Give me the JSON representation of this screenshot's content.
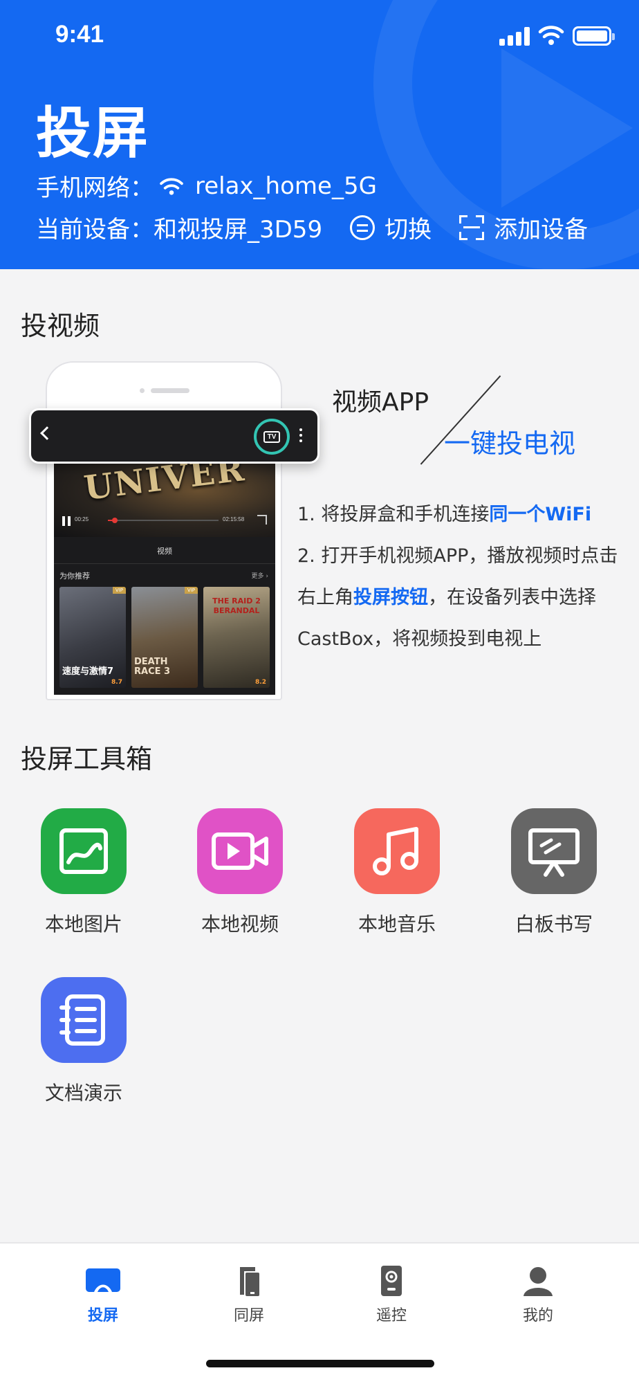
{
  "status_bar": {
    "time": "9:41"
  },
  "header": {
    "title": "投屏",
    "network_label": "手机网络：",
    "network_name": "relax_home_5G",
    "device_label": "当前设备：",
    "device_name": "和视投屏_3D59",
    "switch_label": "切换",
    "add_device_label": "添加设备"
  },
  "cast_video": {
    "section_title": "投视频",
    "slogan_top": "视频APP",
    "slogan_bottom": "一键投电视",
    "mock": {
      "brand_text": "UNIVER",
      "current_time": "00:25",
      "total_time": "02:15:58",
      "progress": 0.06,
      "tab_label": "视频",
      "recommend_label": "为你推荐",
      "more_label": "更多 ›",
      "tv_button_label": "TV",
      "posters": [
        {
          "title": "速度与激情7",
          "rating": "8.7",
          "badge": "VIP"
        },
        {
          "title": "DEATH RACE 3",
          "rating": "",
          "badge": "VIP"
        },
        {
          "title": "THE RAID 2 BERANDAL",
          "rating": "8.2",
          "badge": ""
        }
      ]
    },
    "step1_prefix": "1. 将投屏盒和手机连接",
    "step1_highlight": "同一个WiFi",
    "step2_prefix": "2. 打开手机视频APP，播放视频时点击右上角",
    "step2_highlight": "投屏按钮",
    "step2_suffix": "，在设备列表中选择CastBox，将视频投到电视上"
  },
  "toolbox": {
    "section_title": "投屏工具箱",
    "tools": [
      {
        "label": "本地图片",
        "icon": "image-icon",
        "color": "#22ab46"
      },
      {
        "label": "本地视频",
        "icon": "video-camera-icon",
        "color": "#e052c6"
      },
      {
        "label": "本地音乐",
        "icon": "music-note-icon",
        "color": "#f6685d"
      },
      {
        "label": "白板书写",
        "icon": "whiteboard-icon",
        "color": "#666666"
      },
      {
        "label": "文档演示",
        "icon": "document-icon",
        "color": "#4d6ef0"
      }
    ]
  },
  "tabbar": {
    "tabs": [
      {
        "label": "投屏",
        "icon": "cast-icon",
        "active": true
      },
      {
        "label": "同屏",
        "icon": "mirror-phone-icon",
        "active": false
      },
      {
        "label": "遥控",
        "icon": "remote-icon",
        "active": false
      },
      {
        "label": "我的",
        "icon": "user-icon",
        "active": false
      }
    ]
  },
  "colors": {
    "brand_blue": "#1469f2",
    "page_bg": "#f4f4f5",
    "tv_ring": "#33c5b3"
  }
}
